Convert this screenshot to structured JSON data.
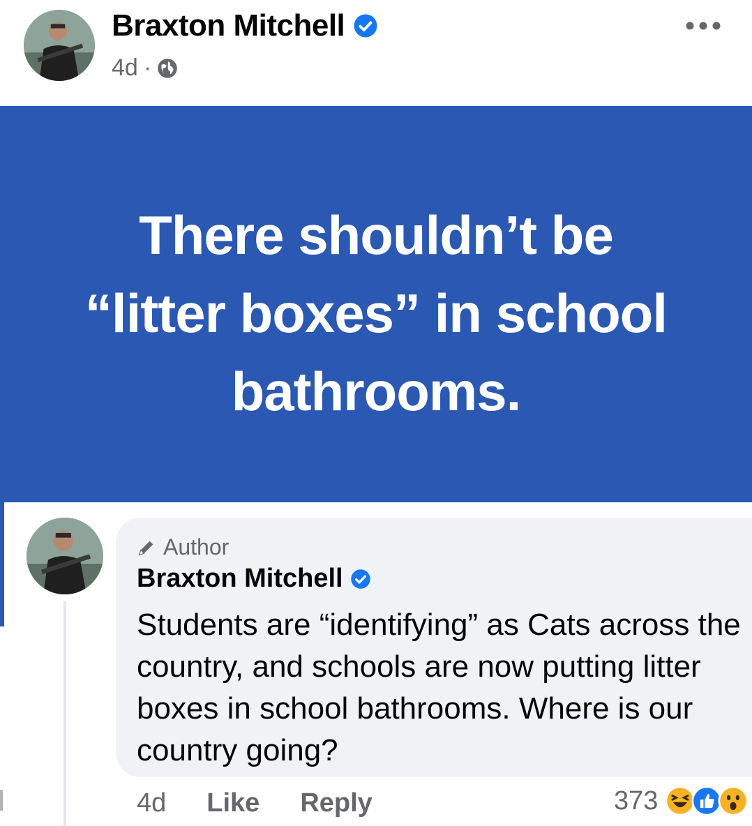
{
  "post": {
    "author_name": "Braxton Mitchell",
    "time": "4d",
    "separator": "·",
    "visibility_icon": "globe-icon",
    "more_icon": "more-options-icon"
  },
  "text_card": {
    "text": "There shouldn’t be “litter boxes” in school bathrooms.",
    "background_color": "#2a58b3",
    "text_color": "#ffffff"
  },
  "comment": {
    "author_tag": "Author",
    "author_name": "Braxton Mitchell",
    "text": "Students are “identifying” as Cats across the country, and schools are now putting litter boxes in school bathrooms. Where is our country going?",
    "time": "4d",
    "like_label": "Like",
    "reply_label": "Reply",
    "reaction_count": "373",
    "reaction_icons": [
      "haha-icon",
      "like-icon",
      "wow-icon"
    ]
  },
  "colors": {
    "verified": "#1877f2",
    "secondary_text": "#65676b",
    "bubble": "#f0f2f5"
  }
}
